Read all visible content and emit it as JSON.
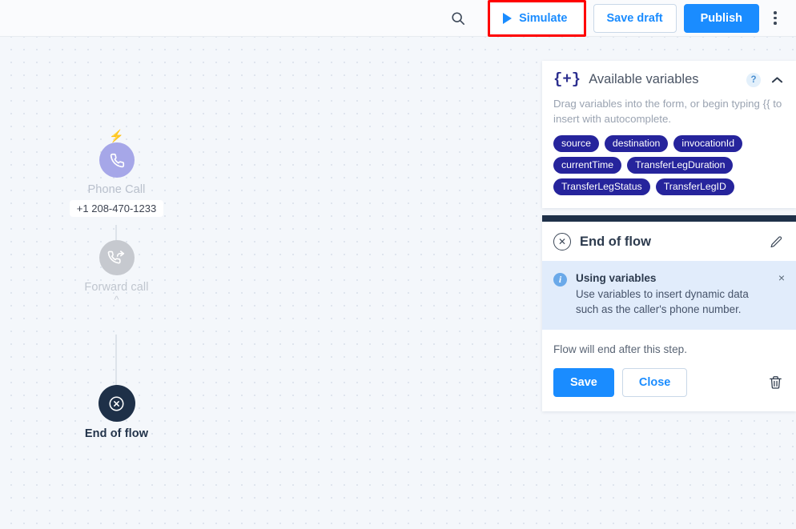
{
  "toolbar": {
    "search_icon": "search-icon",
    "simulate_label": "Simulate",
    "save_draft_label": "Save draft",
    "publish_label": "Publish",
    "kebab_icon": "more-vertical-icon",
    "highlight_color": "#ff0000",
    "accent_color": "#1a8cff"
  },
  "canvas": {
    "nodes": [
      {
        "id": "phone-call",
        "label": "Phone Call",
        "icon": "phone-icon",
        "sublabel": "+1 208-470-1233",
        "trigger_icon": "lightning-bolt-icon",
        "color": "#a6a7e8"
      },
      {
        "id": "forward-call",
        "label": "Forward call",
        "icon": "phone-forward-icon",
        "color": "#c6c9cf",
        "collapse_icon": "chevron-up-icon"
      },
      {
        "id": "end-of-flow",
        "label": "End of flow",
        "icon": "circle-x-icon",
        "color": "#1e3048"
      }
    ]
  },
  "variables_panel": {
    "icon": "curly-braces-plus-icon",
    "title": "Available variables",
    "help_label": "?",
    "collapse_icon": "chevron-up-icon",
    "description": "Drag variables into the form, or begin typing {{ to insert with autocomplete.",
    "chips": [
      "source",
      "destination",
      "invocationId",
      "currentTime",
      "TransferLegDuration",
      "TransferLegStatus",
      "TransferLegID"
    ],
    "chip_color": "#26249c"
  },
  "step_panel": {
    "header_icon": "circle-x-icon",
    "title": "End of flow",
    "edit_icon": "pencil-icon",
    "alert": {
      "icon": "info-icon",
      "title": "Using variables",
      "text": "Use variables to insert dynamic data such as the caller's phone number.",
      "close_icon": "close-icon",
      "close_label": "×"
    },
    "body_text": "Flow will end after this step.",
    "save_label": "Save",
    "close_label": "Close",
    "delete_icon": "trash-icon"
  }
}
